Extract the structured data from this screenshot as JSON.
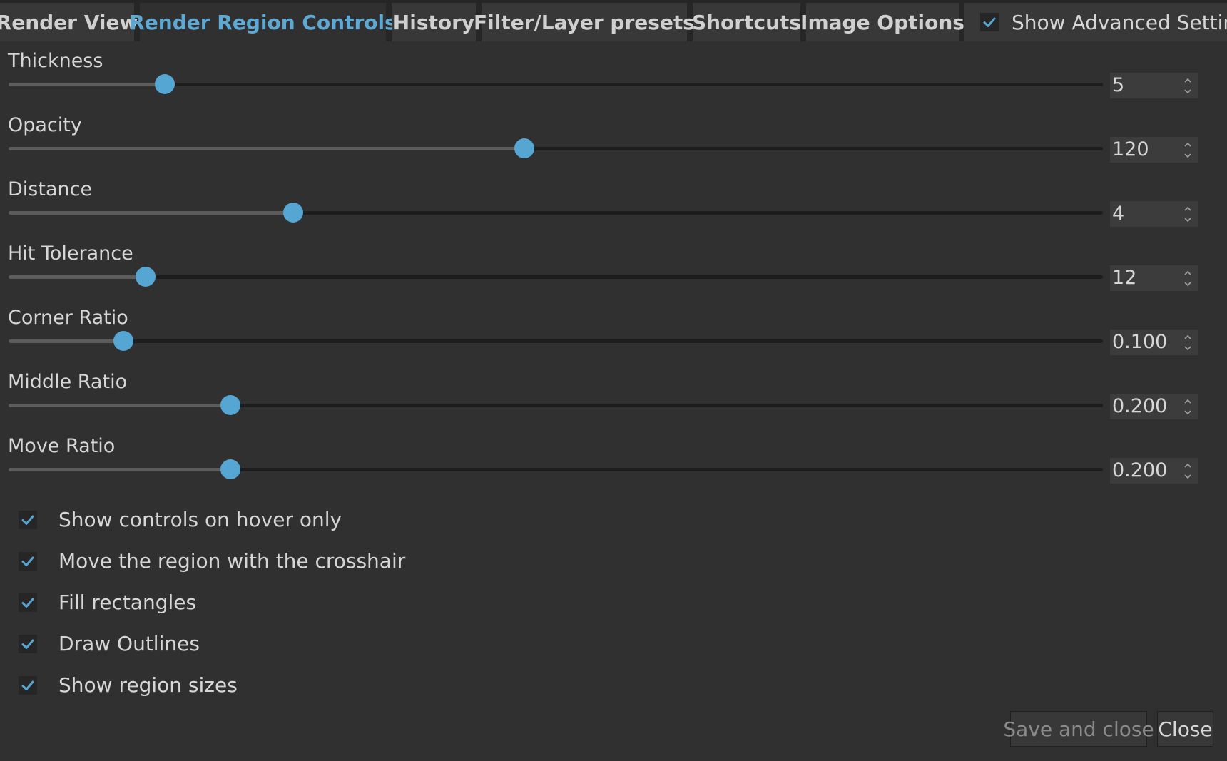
{
  "tabs": [
    {
      "label": "Render View",
      "active": false
    },
    {
      "label": "Render Region Controls",
      "active": true
    },
    {
      "label": "History",
      "active": false
    },
    {
      "label": "Filter/Layer presets",
      "active": false
    },
    {
      "label": "Shortcuts",
      "active": false
    },
    {
      "label": "Image Options",
      "active": false
    }
  ],
  "advanced": {
    "label": "Show Advanced Settings",
    "checked": true
  },
  "sliders": [
    {
      "label": "Thickness",
      "value": "5",
      "fraction": 0.143
    },
    {
      "label": "Opacity",
      "value": "120",
      "fraction": 0.471
    },
    {
      "label": "Distance",
      "value": "4",
      "fraction": 0.26
    },
    {
      "label": "Hit Tolerance",
      "value": "12",
      "fraction": 0.125
    },
    {
      "label": "Corner Ratio",
      "value": "0.100",
      "fraction": 0.105
    },
    {
      "label": "Middle Ratio",
      "value": "0.200",
      "fraction": 0.203
    },
    {
      "label": "Move Ratio",
      "value": "0.200",
      "fraction": 0.203
    }
  ],
  "checkboxes": [
    {
      "label": "Show controls on hover only",
      "checked": true
    },
    {
      "label": "Move the region with the crosshair",
      "checked": true
    },
    {
      "label": "Fill rectangles",
      "checked": true
    },
    {
      "label": "Draw Outlines",
      "checked": true
    },
    {
      "label": "Show region sizes",
      "checked": true
    }
  ],
  "buttons": {
    "save": "Save and close",
    "close": "Close"
  },
  "colors": {
    "accent": "#56a6d4",
    "background": "#303030",
    "tab_bg": "#383838"
  },
  "icons": {
    "check": "checkmark-icon",
    "spin_up": "chevron-up-icon",
    "spin_down": "chevron-down-icon"
  }
}
